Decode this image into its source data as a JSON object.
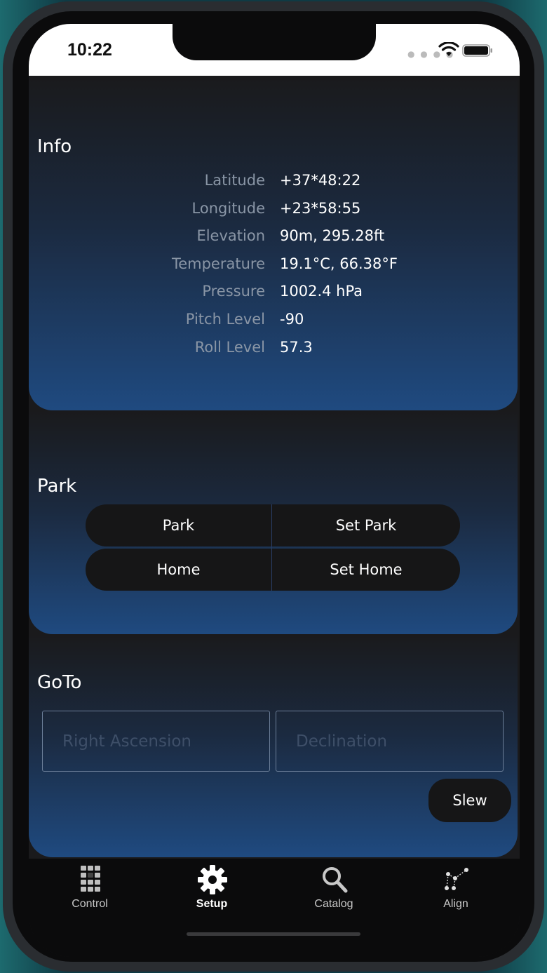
{
  "status": {
    "time": "10:22"
  },
  "info": {
    "title": "Info",
    "rows": [
      {
        "label": "Latitude",
        "value": "+37*48:22"
      },
      {
        "label": "Longitude",
        "value": "+23*58:55"
      },
      {
        "label": "Elevation",
        "value": "90m, 295.28ft"
      },
      {
        "label": "Temperature",
        "value": "19.1°C, 66.38°F"
      },
      {
        "label": "Pressure",
        "value": "1002.4 hPa"
      },
      {
        "label": "Pitch Level",
        "value": "-90"
      },
      {
        "label": "Roll Level",
        "value": "57.3"
      }
    ]
  },
  "park": {
    "title": "Park",
    "buttons": {
      "park": "Park",
      "set_park": "Set Park",
      "home": "Home",
      "set_home": "Set Home"
    }
  },
  "goto": {
    "title": "GoTo",
    "ra_placeholder": "Right Ascension",
    "dec_placeholder": "Declination",
    "slew": "Slew"
  },
  "tabs": [
    {
      "label": "Control",
      "icon": "grid-icon",
      "active": false
    },
    {
      "label": "Setup",
      "icon": "gear-icon",
      "active": true
    },
    {
      "label": "Catalog",
      "icon": "search-icon",
      "active": false
    },
    {
      "label": "Align",
      "icon": "constellation-icon",
      "active": false
    }
  ],
  "colors": {
    "accent": "#1f4a80",
    "background": "#1a1a1c",
    "button": "#161617"
  }
}
